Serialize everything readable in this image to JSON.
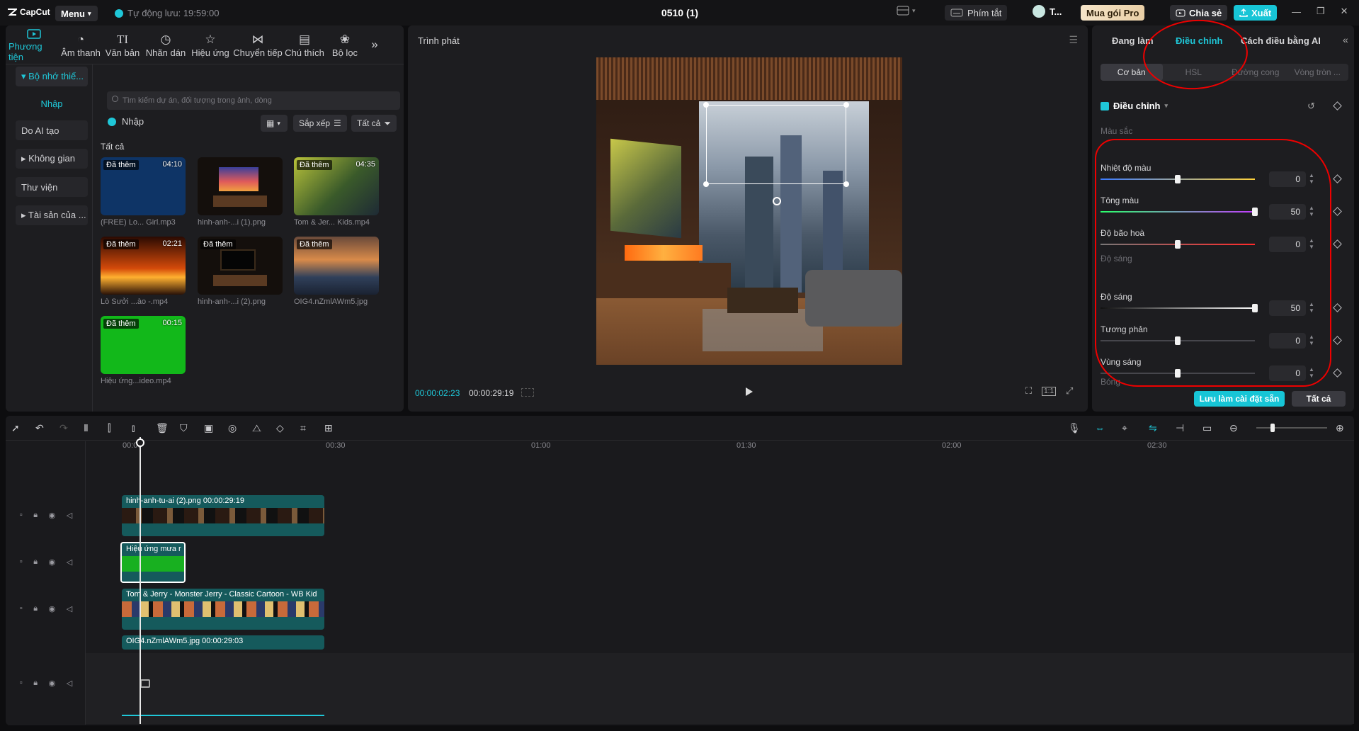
{
  "app": {
    "logo": "CapCut",
    "menu_label": "Menu",
    "autosave": "Tự động lưu: 19:59:00",
    "project_title": "0510 (1)",
    "shortcuts_label": "Phím tắt",
    "user_label": "T...",
    "pro_label": "Mua gói Pro",
    "share_label": "Chia sẻ",
    "export_label": "Xuất"
  },
  "media_tabs": [
    {
      "label": "Phương tiện",
      "icon": "media-icon"
    },
    {
      "label": "Âm thanh",
      "icon": "audio-icon"
    },
    {
      "label": "Văn bản",
      "icon": "text-icon"
    },
    {
      "label": "Nhãn dán",
      "icon": "sticker-icon"
    },
    {
      "label": "Hiệu ứng",
      "icon": "effects-icon"
    },
    {
      "label": "Chuyển tiếp",
      "icon": "transition-icon"
    },
    {
      "label": "Chú thích",
      "icon": "caption-icon"
    },
    {
      "label": "Bộ lọc",
      "icon": "filter-icon"
    }
  ],
  "sidebar": [
    {
      "label": "▾ Bộ nhớ thiế..."
    },
    {
      "label": "Nhập"
    },
    {
      "label": "Do AI tạo"
    },
    {
      "label": "▸ Không gian"
    },
    {
      "label": "Thư viện"
    },
    {
      "label": "▸ Tài sản của ..."
    }
  ],
  "media": {
    "search_placeholder": "Tìm kiếm dự án, đối tượng trong ảnh, dòng",
    "import_label": "Nhập",
    "sort_label": "Sắp xếp",
    "filter_label": "Tất cả",
    "section_label": "Tất cả",
    "items": [
      {
        "tag": "Đã thêm",
        "duration": "04:10",
        "name": "(FREE) Lo... Girl.mp3"
      },
      {
        "tag": "",
        "duration": "",
        "name": "hinh-anh-...i (1).png"
      },
      {
        "tag": "Đã thêm",
        "duration": "04:35",
        "name": "Tom & Jer... Kids.mp4"
      },
      {
        "tag": "Đã thêm",
        "duration": "02:21",
        "name": "Lò Sưởi ...ào -.mp4"
      },
      {
        "tag": "Đã thêm",
        "duration": "",
        "name": "hinh-anh-...i (2).png"
      },
      {
        "tag": "Đã thêm",
        "duration": "",
        "name": "OIG4.nZmlAWm5.jpg"
      },
      {
        "tag": "Đã thêm",
        "duration": "00:15",
        "name": "Hiệu ứng...ideo.mp4"
      }
    ]
  },
  "player": {
    "title": "Trình phát",
    "current_time": "00:00:02:23",
    "total_time": "00:00:29:19",
    "ratio_label": "1:1"
  },
  "adjust": {
    "tabs": [
      "Đang làm",
      "Điều chỉnh",
      "Cách điều bằng AI"
    ],
    "sub_tabs": [
      "Cơ bản",
      "HSL",
      "Đường cong",
      "Vòng tròn ..."
    ],
    "section_title": "Điều chỉnh",
    "group_color": "Màu sắc",
    "group_light": "Độ sáng",
    "group_shadow": "Bóng",
    "sliders": [
      {
        "label": "Nhiệt độ màu",
        "value": "0",
        "level": 0.5
      },
      {
        "label": "Tông màu",
        "value": "50",
        "level": 1.0
      },
      {
        "label": "Độ bão hoà",
        "value": "0",
        "level": 0.5
      },
      {
        "label": "Độ sáng",
        "value": "50",
        "level": 1.0
      },
      {
        "label": "Tương phản",
        "value": "0",
        "level": 0.5
      },
      {
        "label": "Vùng sáng",
        "value": "0",
        "level": 0.5
      }
    ],
    "save_preset_label": "Lưu làm cài đặt sẵn",
    "apply_all_label": "Tất cả"
  },
  "timeline": {
    "ruler": [
      "00:00",
      "00:30",
      "01:00",
      "01:30",
      "02:00",
      "02:30"
    ],
    "clips": [
      {
        "title": "hinh-anh-tu-ai (2).png   00:00:29:19"
      },
      {
        "title": "Hiệu ứng mưa r"
      },
      {
        "title": "Tom & Jerry - Monster Jerry - Classic Cartoon - WB Kid"
      },
      {
        "title": "OIG4.nZmlAWm5.jpg   00:00:29:03"
      }
    ]
  },
  "colors": {
    "accent": "#1fc7d8",
    "annotation": "#e00000",
    "clip": "#155a5c"
  }
}
